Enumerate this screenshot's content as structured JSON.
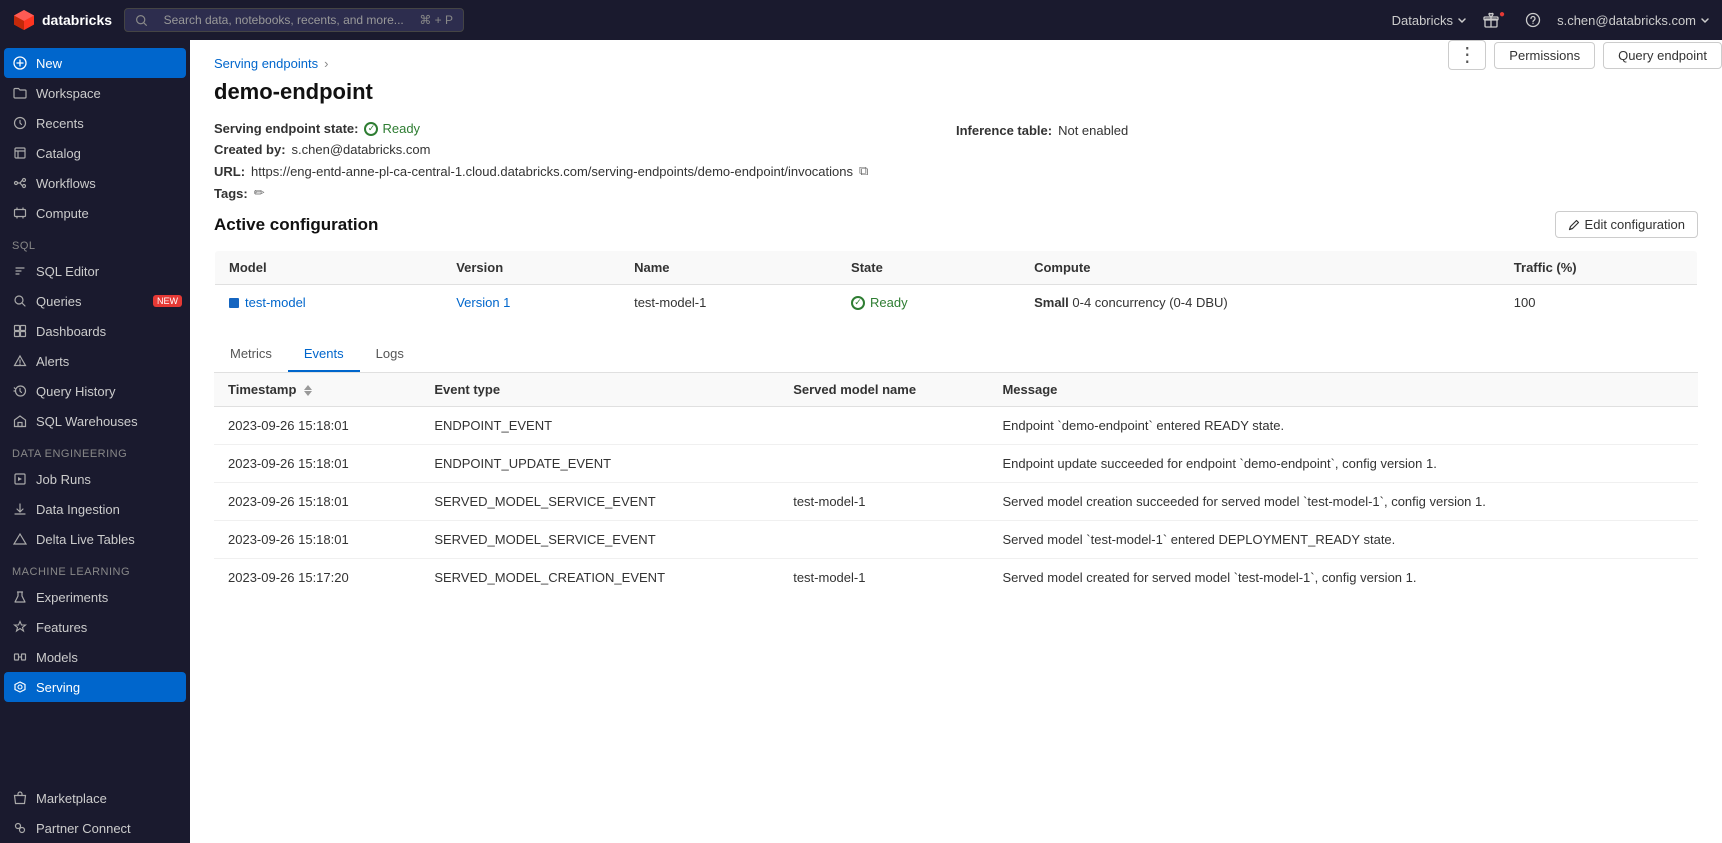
{
  "app": {
    "name": "Databricks",
    "logo_text": "databricks"
  },
  "header": {
    "search_placeholder": "Search data, notebooks, recents, and more...",
    "search_shortcut": "⌘ + P",
    "workspace_selector": "Databricks",
    "gift_icon": "gift-icon",
    "help_icon": "help-icon",
    "user_email": "s.chen@databricks.com"
  },
  "sidebar": {
    "items": [
      {
        "id": "new",
        "label": "New",
        "icon": "plus-icon",
        "active": true
      },
      {
        "id": "workspace",
        "label": "Workspace",
        "icon": "folder-icon"
      },
      {
        "id": "recents",
        "label": "Recents",
        "icon": "clock-icon"
      },
      {
        "id": "catalog",
        "label": "Catalog",
        "icon": "catalog-icon"
      },
      {
        "id": "workflows",
        "label": "Workflows",
        "icon": "workflow-icon"
      },
      {
        "id": "compute",
        "label": "Compute",
        "icon": "compute-icon"
      }
    ],
    "sections": [
      {
        "label": "SQL",
        "items": [
          {
            "id": "sql-editor",
            "label": "SQL Editor",
            "icon": "sql-icon"
          },
          {
            "id": "queries",
            "label": "Queries",
            "icon": "queries-icon",
            "badge": "NEW"
          },
          {
            "id": "dashboards",
            "label": "Dashboards",
            "icon": "dashboard-icon"
          },
          {
            "id": "alerts",
            "label": "Alerts",
            "icon": "alert-icon"
          },
          {
            "id": "query-history",
            "label": "Query History",
            "icon": "history-icon"
          },
          {
            "id": "sql-warehouses",
            "label": "SQL Warehouses",
            "icon": "warehouse-icon"
          }
        ]
      },
      {
        "label": "Data Engineering",
        "items": [
          {
            "id": "job-runs",
            "label": "Job Runs",
            "icon": "job-icon"
          },
          {
            "id": "data-ingestion",
            "label": "Data Ingestion",
            "icon": "ingestion-icon"
          },
          {
            "id": "delta-live-tables",
            "label": "Delta Live Tables",
            "icon": "delta-icon"
          }
        ]
      },
      {
        "label": "Machine Learning",
        "items": [
          {
            "id": "experiments",
            "label": "Experiments",
            "icon": "experiments-icon"
          },
          {
            "id": "features",
            "label": "Features",
            "icon": "features-icon"
          },
          {
            "id": "models",
            "label": "Models",
            "icon": "models-icon"
          },
          {
            "id": "serving",
            "label": "Serving",
            "icon": "serving-icon",
            "active": true
          }
        ]
      }
    ],
    "bottom_items": [
      {
        "id": "marketplace",
        "label": "Marketplace",
        "icon": "marketplace-icon"
      },
      {
        "id": "partner-connect",
        "label": "Partner Connect",
        "icon": "partner-icon"
      }
    ]
  },
  "breadcrumb": {
    "parent": "Serving endpoints",
    "separator": "›",
    "current": "demo-endpoint"
  },
  "page": {
    "title": "demo-endpoint",
    "state_label": "Serving endpoint state:",
    "state_value": "Ready",
    "created_by_label": "Created by:",
    "created_by_value": "s.chen@databricks.com",
    "url_label": "URL:",
    "url_value": "https://eng-entd-anne-pl-ca-central-1.cloud.databricks.com/serving-endpoints/demo-endpoint/invocations",
    "tags_label": "Tags:",
    "inference_label": "Inference table:",
    "inference_value": "Not enabled"
  },
  "toolbar": {
    "more_label": "⋮",
    "permissions_label": "Permissions",
    "query_endpoint_label": "Query endpoint"
  },
  "active_config": {
    "title": "Active configuration",
    "edit_label": "Edit configuration",
    "columns": [
      "Model",
      "Version",
      "Name",
      "State",
      "Compute",
      "Traffic (%)"
    ],
    "rows": [
      {
        "model": "test-model",
        "version": "Version 1",
        "name": "test-model-1",
        "state": "Ready",
        "compute": "Small 0-4 concurrency (0-4 DBU)",
        "traffic": "100"
      }
    ]
  },
  "tabs": {
    "items": [
      "Metrics",
      "Events",
      "Logs"
    ],
    "active": "Events"
  },
  "events_table": {
    "columns": [
      {
        "label": "Timestamp",
        "sortable": true
      },
      {
        "label": "Event type",
        "sortable": false
      },
      {
        "label": "Served model name",
        "sortable": false
      },
      {
        "label": "Message",
        "sortable": false
      }
    ],
    "rows": [
      {
        "timestamp": "2023-09-26 15:18:01",
        "event_type": "ENDPOINT_EVENT",
        "served_model_name": "",
        "message": "Endpoint `demo-endpoint` entered READY state."
      },
      {
        "timestamp": "2023-09-26 15:18:01",
        "event_type": "ENDPOINT_UPDATE_EVENT",
        "served_model_name": "",
        "message": "Endpoint update succeeded for endpoint `demo-endpoint`, config version 1."
      },
      {
        "timestamp": "2023-09-26 15:18:01",
        "event_type": "SERVED_MODEL_SERVICE_EVENT",
        "served_model_name": "test-model-1",
        "message": "Served model creation succeeded for served model `test-model-1`, config version 1."
      },
      {
        "timestamp": "2023-09-26 15:18:01",
        "event_type": "SERVED_MODEL_SERVICE_EVENT",
        "served_model_name": "",
        "message": "Served model `test-model-1` entered DEPLOYMENT_READY state."
      },
      {
        "timestamp": "2023-09-26 15:17:20",
        "event_type": "SERVED_MODEL_CREATION_EVENT",
        "served_model_name": "test-model-1",
        "message": "Served model created for served model `test-model-1`, config version 1."
      }
    ]
  }
}
